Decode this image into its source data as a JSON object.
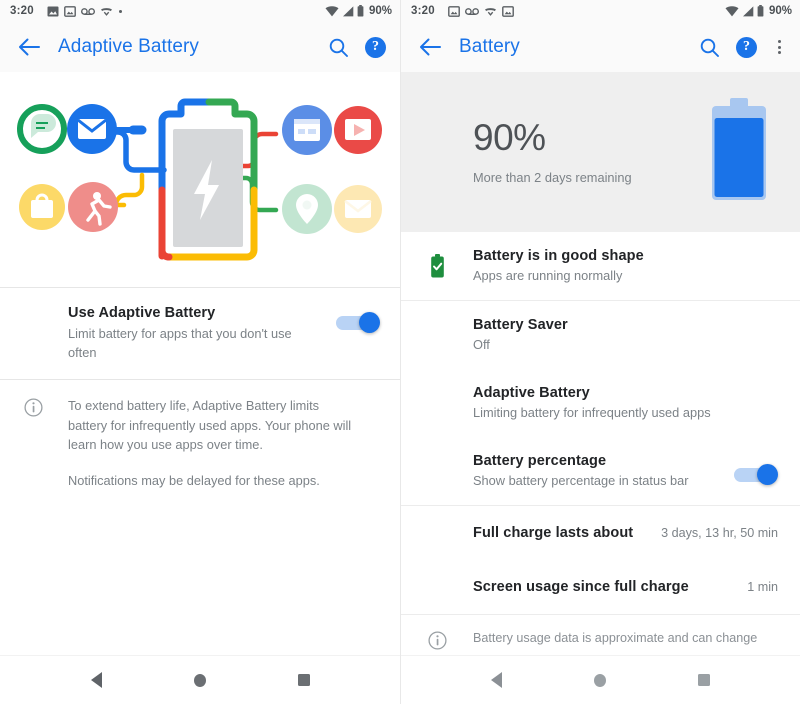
{
  "status_bar": {
    "time": "3:20",
    "battery_percent": "90%",
    "left_icons_screen1": [
      "image-icon",
      "photo-frame-icon",
      "voicemail-icon",
      "missed-call-icon",
      "dot-icon"
    ],
    "left_icons_screen2": [
      "photo-frame-icon",
      "voicemail-icon",
      "missed-call-icon",
      "photo-frame-icon"
    ],
    "right_icons": [
      "wifi-icon",
      "signal-icon",
      "battery-icon"
    ]
  },
  "colors": {
    "accent_blue": "#1a73e8",
    "google_red": "#ea4335",
    "google_green": "#34a853",
    "google_yellow": "#fbbc04",
    "summary_bg": "#efefef",
    "text_primary": "#222427",
    "text_secondary": "#7c8287"
  },
  "left_screen": {
    "toolbar": {
      "back_label": "Back",
      "title": "Adaptive Battery",
      "search_label": "Search",
      "help_label": "?"
    },
    "illustration": {
      "name": "adaptive-battery-illustration",
      "apps_left": [
        "messages-icon",
        "email-icon",
        "shopping-bag-icon",
        "fitness-run-icon"
      ],
      "apps_right": [
        "calendar-icon",
        "video-play-icon",
        "location-pin-icon",
        "mail-icon"
      ],
      "center": "battery-bolt-icon"
    },
    "setting": {
      "title": "Use Adaptive Battery",
      "subtitle": "Limit battery for apps that you don't use often",
      "toggle_state": "on"
    },
    "info": {
      "icon": "info-icon",
      "paragraph_1": "To extend battery life, Adaptive Battery limits battery for infrequently used apps. Your phone will learn how you use apps over time.",
      "paragraph_2": "Notifications may be delayed for these apps."
    }
  },
  "right_screen": {
    "toolbar": {
      "back_label": "Back",
      "title": "Battery",
      "search_label": "Search",
      "help_label": "?",
      "overflow_label": "More options"
    },
    "summary": {
      "percent": "90%",
      "remaining": "More than 2 days remaining",
      "battery_art": "battery-full-icon"
    },
    "items": [
      {
        "icon": "battery-check-icon",
        "title": "Battery is in good shape",
        "subtitle": "Apps are running normally"
      },
      {
        "title": "Battery Saver",
        "subtitle": "Off"
      },
      {
        "title": "Adaptive Battery",
        "subtitle": "Limiting battery for infrequently used apps"
      },
      {
        "title": "Battery percentage",
        "subtitle": "Show battery percentage in status bar",
        "toggle_state": "on"
      }
    ],
    "value_rows": [
      {
        "title": "Full charge lasts about",
        "value": "3 days, 13 hr, 50 min"
      },
      {
        "title": "Screen usage since full charge",
        "value": "1 min"
      }
    ],
    "footer_info": {
      "icon": "info-icon",
      "text": "Battery usage data is approximate and can change"
    }
  },
  "nav_bar": {
    "back": "back-triangle-icon",
    "home": "home-circle-icon",
    "recents": "recents-square-icon"
  }
}
